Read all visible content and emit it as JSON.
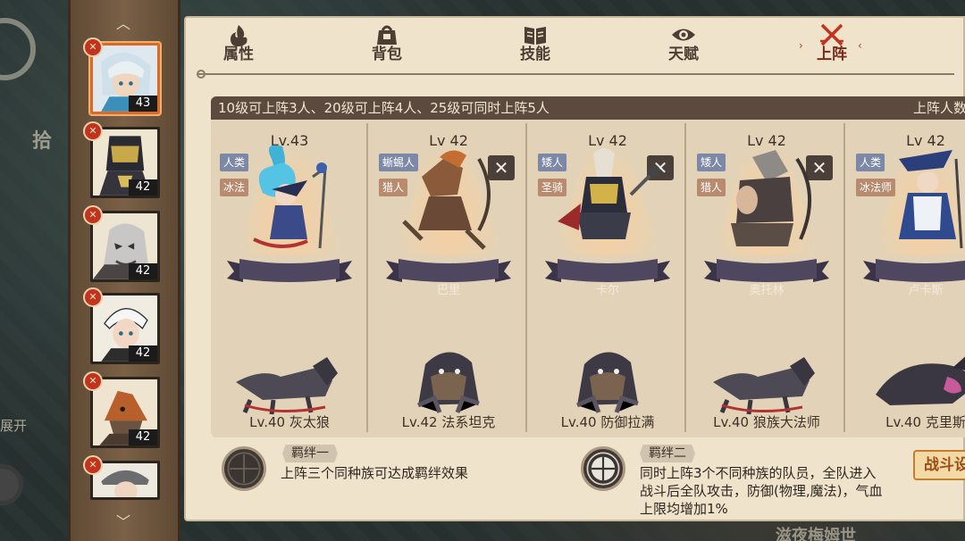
{
  "tabs": [
    {
      "label": "属性",
      "icon": "flame-icon"
    },
    {
      "label": "背包",
      "icon": "bag-icon"
    },
    {
      "label": "技能",
      "icon": "book-icon"
    },
    {
      "label": "天赋",
      "icon": "eye-icon"
    },
    {
      "label": "上阵",
      "icon": "crossed-swords-icon",
      "active": true
    }
  ],
  "heroes": [
    {
      "level": "43",
      "selected": true
    },
    {
      "level": "42"
    },
    {
      "level": "42"
    },
    {
      "level": "42"
    },
    {
      "level": "42"
    },
    {
      "level": ""
    }
  ],
  "lineup": {
    "header": "10级可上阵3人、20级可上阵4人、25级可同时上阵5人",
    "header_right": "上阵人数",
    "slots": [
      {
        "level": "Lv.43",
        "race": "人类",
        "cls": "冰法",
        "name": "",
        "pet": "Lv.40 灰太狼",
        "removable": false
      },
      {
        "level": "Lv 42",
        "race": "蜥蜴人",
        "cls": "猎人",
        "name": "巴里",
        "pet": "Lv.42 法系坦克",
        "removable": true
      },
      {
        "level": "Lv 42",
        "race": "矮人",
        "cls": "圣骑",
        "name": "卡尔",
        "pet": "Lv.40 防御拉满",
        "removable": true
      },
      {
        "level": "Lv 42",
        "race": "矮人",
        "cls": "猎人",
        "name": "奥托林",
        "pet": "Lv.40 狼族大法师",
        "removable": true
      },
      {
        "level": "Lv 42",
        "race": "人类",
        "cls": "冰法师",
        "name": "卢卡斯",
        "pet": "Lv.40 克里斯",
        "removable": false
      }
    ]
  },
  "bonds": [
    {
      "title": "羁绊一",
      "desc": "上阵三个同种族可达成羁绊效果"
    },
    {
      "title": "羁绊二",
      "desc_lines": [
        "同时上阵3个不同种族的队员，全队进入",
        "战斗后全队攻击，防御(物理,魔法)，气血",
        "上限均增加1%"
      ]
    }
  ],
  "fight_button": "战斗设",
  "background": {
    "left_text": "拾",
    "left_text2": "展开",
    "bottom_text": "滋夜梅姆世"
  },
  "colors": {
    "panel": "#efe3cc",
    "header": "#5b4a3d",
    "ribbon": "#4f4660",
    "accent": "#c2331d"
  }
}
